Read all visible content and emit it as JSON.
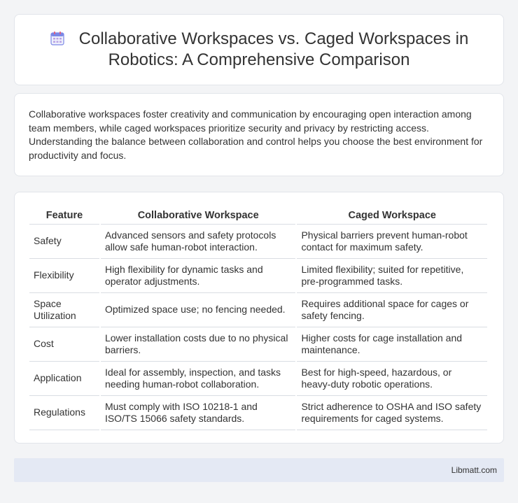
{
  "header": {
    "icon": "calendar-icon",
    "title": "Collaborative Workspaces vs. Caged Workspaces in Robotics: A Comprehensive Comparison"
  },
  "intro": {
    "text": "Collaborative workspaces foster creativity and communication by encouraging open interaction among team members, while caged workspaces prioritize security and privacy by restricting access. Understanding the balance between collaboration and control helps you choose the best environment for productivity and focus."
  },
  "table": {
    "headers": [
      "Feature",
      "Collaborative Workspace",
      "Caged Workspace"
    ],
    "rows": [
      [
        "Safety",
        "Advanced sensors and safety protocols allow safe human-robot interaction.",
        "Physical barriers prevent human-robot contact for maximum safety."
      ],
      [
        "Flexibility",
        "High flexibility for dynamic tasks and operator adjustments.",
        "Limited flexibility; suited for repetitive, pre-programmed tasks."
      ],
      [
        "Space Utilization",
        "Optimized space use; no fencing needed.",
        "Requires additional space for cages or safety fencing."
      ],
      [
        "Cost",
        "Lower installation costs due to no physical barriers.",
        "Higher costs for cage installation and maintenance."
      ],
      [
        "Application",
        "Ideal for assembly, inspection, and tasks needing human-robot collaboration.",
        "Best for high-speed, hazardous, or heavy-duty robotic operations."
      ],
      [
        "Regulations",
        "Must comply with ISO 10218-1 and ISO/TS 15066 safety standards.",
        "Strict adherence to OSHA and ISO safety requirements for caged systems."
      ]
    ]
  },
  "footer": {
    "brand": "Libmatt.com"
  },
  "colors": {
    "page_background": "#f3f4f6",
    "card_background": "#ffffff",
    "footer_background": "#e4e9f4",
    "icon_accent": "#6f7fe6"
  }
}
